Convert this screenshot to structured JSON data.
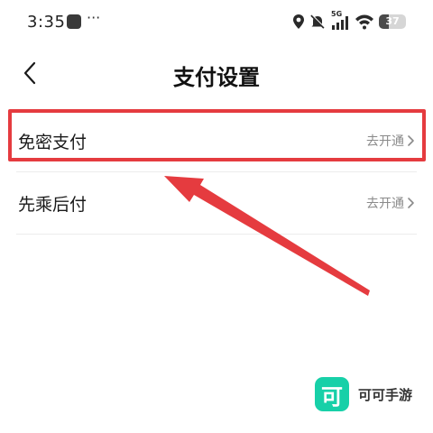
{
  "status_bar": {
    "time": "3:35",
    "more_indicator": "···",
    "network": "5G",
    "battery_level": "37"
  },
  "header": {
    "title": "支付设置"
  },
  "settings": {
    "items": [
      {
        "label": "免密支付",
        "action": "去开通"
      },
      {
        "label": "先乘后付",
        "action": "去开通"
      }
    ]
  },
  "annotation": {
    "color": "#e53b3f"
  },
  "watermark": {
    "logo_glyph": "可",
    "text": "可可手游",
    "color": "#17d0a8"
  }
}
